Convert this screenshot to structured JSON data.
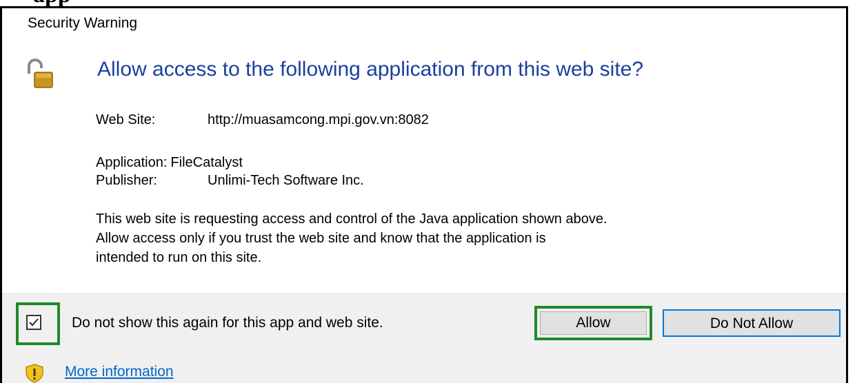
{
  "page_heading_fragment": "app",
  "dialog": {
    "title": "Security Warning",
    "question": "Allow access to the following application from this web site?",
    "web_site_label": "Web Site:",
    "web_site_value": "http://muasamcong.mpi.gov.vn:8082",
    "application_label": "Application:",
    "application_value": "FileCatalyst",
    "publisher_label": "Publisher:",
    "publisher_value": "Unlimi-Tech Software Inc.",
    "description_lines": [
      "This web site is requesting access and control of the Java application shown above.",
      "Allow access only if you trust the web site and know that the application is",
      "intended to run on this site."
    ]
  },
  "footer": {
    "checkbox_label": "Do not show this again for this app and web site.",
    "checkbox_checked": true,
    "allow_label": "Allow",
    "deny_label": "Do Not Allow",
    "more_info_label": "More information"
  },
  "icons": {
    "lock": "padlock-unlocked-icon",
    "shield": "shield-warning-icon",
    "checkbox": "checkmark-icon"
  },
  "colors": {
    "question": "#1a3f9e",
    "highlight": "#1f8a2b",
    "default_button_border": "#0078d7",
    "link": "#0066cc"
  }
}
